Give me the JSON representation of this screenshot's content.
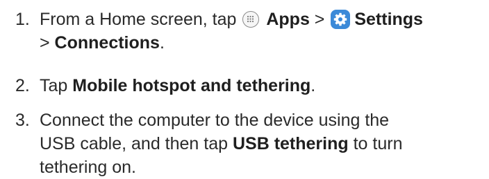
{
  "steps": [
    {
      "number": "1.",
      "line1_before": "From a Home screen, tap ",
      "apps_icon": "apps-icon",
      "apps": "Apps",
      "sep": " > ",
      "settings_icon": "settings-gear-icon",
      "settings": "Settings",
      "line2_before": "> ",
      "connections": "Connections",
      "line2_after": "."
    },
    {
      "number": "2.",
      "before": "Tap ",
      "bold": "Mobile hotspot and tethering",
      "after": "."
    },
    {
      "number": "3.",
      "line1": "Connect the computer to the device using the",
      "line2_before": "USB cable, and then tap ",
      "bold": "USB tethering",
      "line2_after": " to turn",
      "line3": "tethering on."
    }
  ],
  "colors": {
    "text": "#2a2a2a",
    "settings_icon_bg": "#3c8ad8",
    "apps_icon_border": "#8a8a8a"
  }
}
